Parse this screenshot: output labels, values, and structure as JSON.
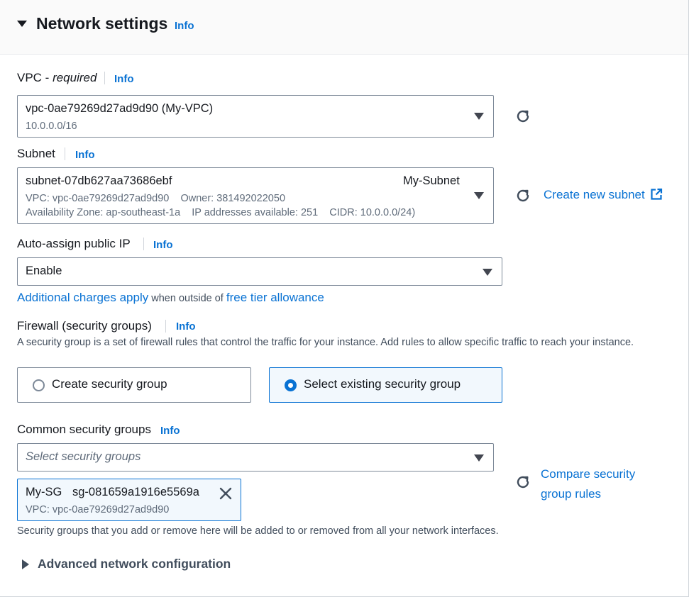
{
  "section": {
    "title": "Network settings",
    "info": "Info"
  },
  "vpc": {
    "label": "VPC - ",
    "label_italic": "required",
    "info": "Info",
    "value": "vpc-0ae79269d27ad9d90 (My-VPC)",
    "cidr": "10.0.0.0/16"
  },
  "subnet": {
    "label": "Subnet",
    "info": "Info",
    "value": "subnet-07db627aa73686ebf",
    "name": "My-Subnet",
    "line2": "VPC: vpc-0ae79269d27ad9d90    Owner: 381492022050",
    "line3": "Availability Zone: ap-southeast-1a    IP addresses available: 251    CIDR: 10.0.0.0/24)",
    "create_link": "Create new subnet"
  },
  "public_ip": {
    "label": "Auto-assign public IP",
    "info": "Info",
    "value": "Enable",
    "charges_link": "Additional charges apply",
    "charges_mid": " when outside of ",
    "free_tier_link": "free tier allowance"
  },
  "firewall": {
    "label": "Firewall (security groups)",
    "info": "Info",
    "description": "A security group is a set of firewall rules that control the traffic for your instance. Add rules to allow specific traffic to reach your instance.",
    "option_create": "Create security group",
    "option_existing": "Select existing security group",
    "selected": "Select existing security group"
  },
  "common_sg": {
    "label": "Common security groups",
    "info": "Info",
    "placeholder": "Select security groups",
    "token_name": "My-SG",
    "token_id": "sg-081659a1916e5569a",
    "token_vpc": "VPC: vpc-0ae79269d27ad9d90",
    "compare_link_1": "Compare security",
    "compare_link_2": "group rules",
    "footnote": "Security groups that you add or remove here will be added to or removed from all your network interfaces."
  },
  "advanced": {
    "label": "Advanced network configuration"
  },
  "colors": {
    "link": "#0972d3",
    "text": "#16191f",
    "muted": "#5f6b7a",
    "border": "#7d8998",
    "selected_bg": "#f2f8fd"
  },
  "icons": [
    "caret-down-icon",
    "refresh-icon",
    "external-link-icon",
    "close-icon",
    "caret-right-icon"
  ]
}
